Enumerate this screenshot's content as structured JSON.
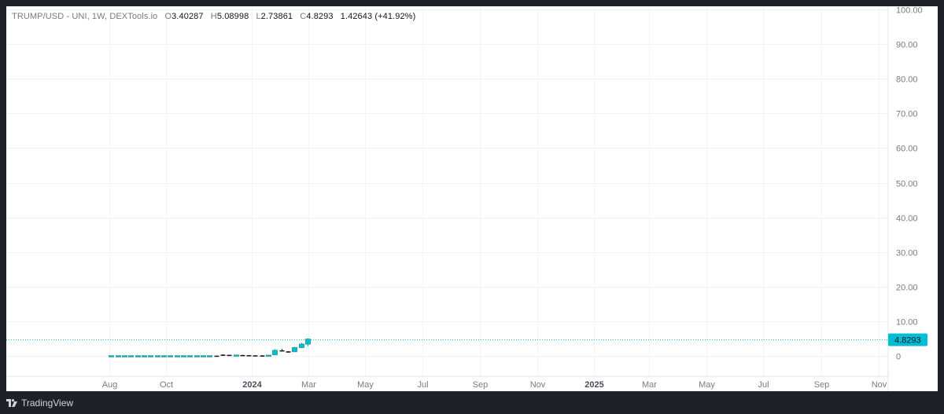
{
  "legend": {
    "symbol": "TRUMP/USD - UNI, 1W, DEXTools.io",
    "open_label": "O",
    "open": "3.40287",
    "high_label": "H",
    "high": "5.08998",
    "low_label": "L",
    "low": "2.73861",
    "close_label": "C",
    "close": "4.8293",
    "change": "1.42643 (+41.92%)"
  },
  "branding": {
    "name": "TradingView"
  },
  "colors": {
    "up": "#26a69a",
    "up_fill": "#00bcd4",
    "down": "#131722",
    "last_price": "#00bcd4",
    "grid": "#f0f3fa"
  },
  "chart_data": {
    "type": "candlestick",
    "ylim": [
      0,
      100
    ],
    "yticks": [
      "100.00",
      "90.00",
      "80.00",
      "70.00",
      "60.00",
      "50.00",
      "40.00",
      "30.00",
      "20.00",
      "10.00",
      "0"
    ],
    "xticks": [
      "Aug",
      "Oct",
      "2024",
      "Mar",
      "May",
      "Jul",
      "Sep",
      "Nov",
      "2025",
      "Mar",
      "May",
      "Jul",
      "Sep",
      "Nov"
    ],
    "last_price": "4.8293",
    "candles": [
      {
        "date": "2023-07-31",
        "open": 0.05,
        "high": 0.06,
        "low": 0.04,
        "close": 0.05
      },
      {
        "date": "2023-08-07",
        "open": 0.05,
        "high": 0.06,
        "low": 0.04,
        "close": 0.05
      },
      {
        "date": "2023-08-14",
        "open": 0.05,
        "high": 0.06,
        "low": 0.04,
        "close": 0.05
      },
      {
        "date": "2023-08-21",
        "open": 0.05,
        "high": 0.06,
        "low": 0.04,
        "close": 0.05
      },
      {
        "date": "2023-08-28",
        "open": 0.05,
        "high": 0.06,
        "low": 0.04,
        "close": 0.05
      },
      {
        "date": "2023-09-04",
        "open": 0.05,
        "high": 0.06,
        "low": 0.04,
        "close": 0.05
      },
      {
        "date": "2023-09-11",
        "open": 0.05,
        "high": 0.06,
        "low": 0.04,
        "close": 0.05
      },
      {
        "date": "2023-09-18",
        "open": 0.05,
        "high": 0.06,
        "low": 0.04,
        "close": 0.05
      },
      {
        "date": "2023-09-25",
        "open": 0.05,
        "high": 0.06,
        "low": 0.04,
        "close": 0.05
      },
      {
        "date": "2023-10-02",
        "open": 0.05,
        "high": 0.06,
        "low": 0.04,
        "close": 0.05
      },
      {
        "date": "2023-10-09",
        "open": 0.05,
        "high": 0.06,
        "low": 0.04,
        "close": 0.05
      },
      {
        "date": "2023-10-16",
        "open": 0.05,
        "high": 0.06,
        "low": 0.04,
        "close": 0.05
      },
      {
        "date": "2023-10-23",
        "open": 0.05,
        "high": 0.06,
        "low": 0.04,
        "close": 0.05
      },
      {
        "date": "2023-10-30",
        "open": 0.05,
        "high": 0.06,
        "low": 0.04,
        "close": 0.05
      },
      {
        "date": "2023-11-06",
        "open": 0.05,
        "high": 0.06,
        "low": 0.04,
        "close": 0.05
      },
      {
        "date": "2023-11-13",
        "open": 0.05,
        "high": 0.06,
        "low": 0.04,
        "close": 0.05
      },
      {
        "date": "2023-11-20",
        "open": 0.06,
        "high": 0.08,
        "low": 0.04,
        "close": 0.05
      },
      {
        "date": "2023-11-27",
        "open": 0.35,
        "high": 0.45,
        "low": 0.05,
        "close": 0.3
      },
      {
        "date": "2023-12-04",
        "open": 0.3,
        "high": 0.35,
        "low": 0.18,
        "close": 0.2
      },
      {
        "date": "2023-12-11",
        "open": 0.2,
        "high": 0.3,
        "low": 0.15,
        "close": 0.25
      },
      {
        "date": "2023-12-18",
        "open": 0.25,
        "high": 0.3,
        "low": 0.15,
        "close": 0.2
      },
      {
        "date": "2023-12-25",
        "open": 0.2,
        "high": 0.25,
        "low": 0.1,
        "close": 0.15
      },
      {
        "date": "2024-01-01",
        "open": 0.15,
        "high": 0.2,
        "low": 0.08,
        "close": 0.12
      },
      {
        "date": "2024-01-08",
        "open": 0.12,
        "high": 0.2,
        "low": 0.08,
        "close": 0.1
      },
      {
        "date": "2024-01-15",
        "open": 0.1,
        "high": 0.25,
        "low": 0.08,
        "close": 0.2
      },
      {
        "date": "2024-01-22",
        "open": 0.3,
        "high": 1.9,
        "low": 0.25,
        "close": 1.6
      },
      {
        "date": "2024-01-29",
        "open": 1.6,
        "high": 2.0,
        "low": 1.4,
        "close": 1.5
      },
      {
        "date": "2024-02-05",
        "open": 1.3,
        "high": 1.4,
        "low": 0.9,
        "close": 1.1
      },
      {
        "date": "2024-02-12",
        "open": 1.2,
        "high": 2.6,
        "low": 1.1,
        "close": 2.4
      },
      {
        "date": "2024-02-19",
        "open": 2.4,
        "high": 3.8,
        "low": 2.2,
        "close": 3.4
      },
      {
        "date": "2024-02-26",
        "open": 3.40287,
        "high": 5.08998,
        "low": 2.73861,
        "close": 4.8293
      }
    ]
  }
}
